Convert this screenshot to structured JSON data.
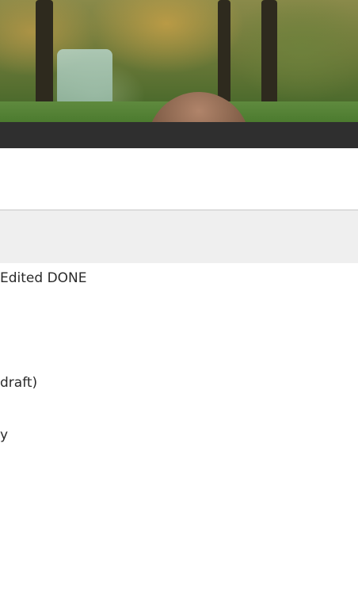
{
  "list": {
    "items": [
      {
        "text": "Edited DONE"
      },
      {
        "text": "draft)"
      },
      {
        "text": "y"
      }
    ]
  }
}
